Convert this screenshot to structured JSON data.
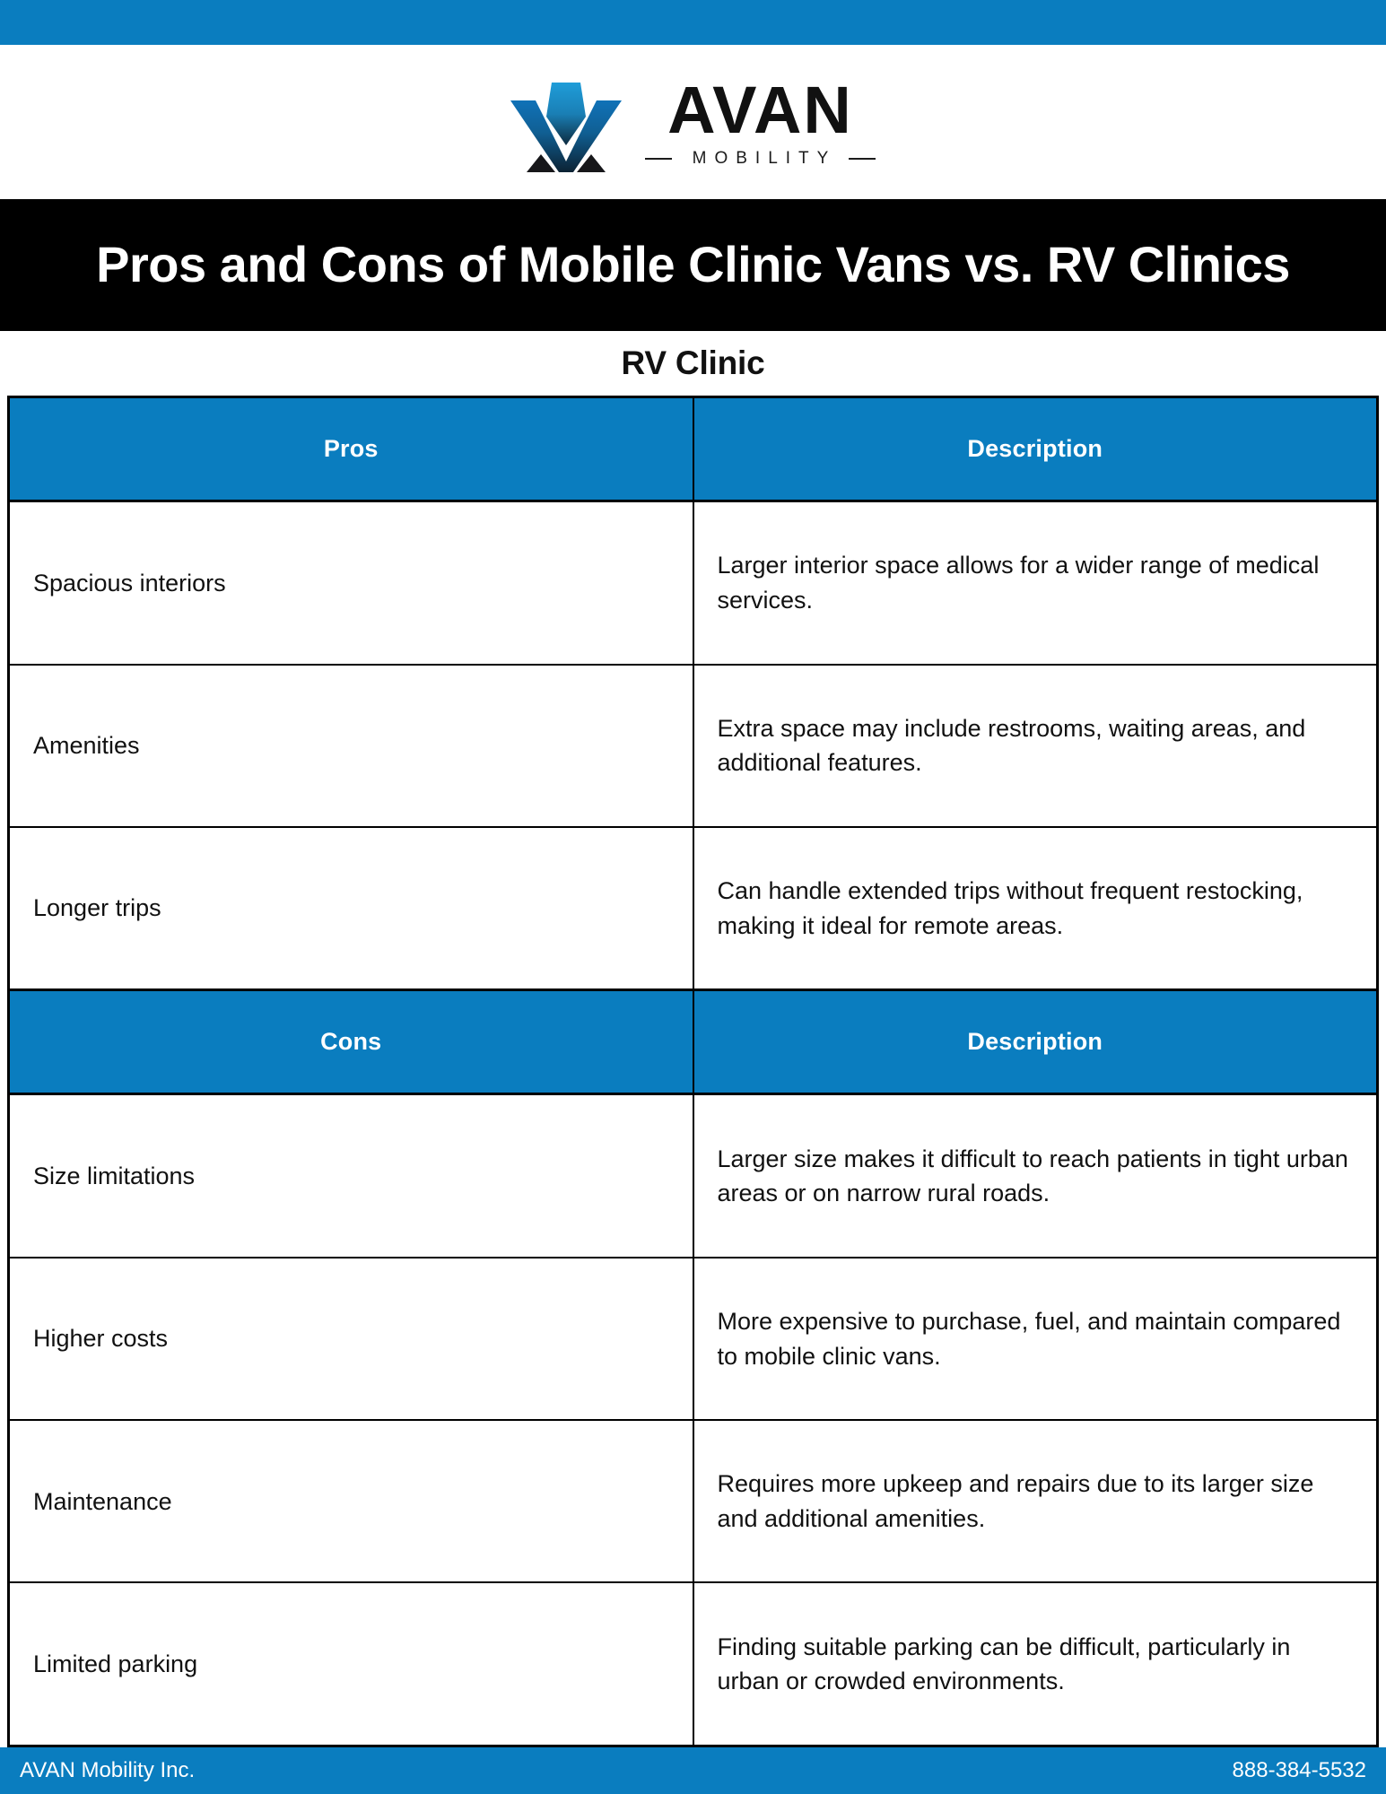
{
  "brand": {
    "accent_color": "#0a7dbf",
    "banner_color": "#000000",
    "logo_word": "AVAN",
    "logo_subtitle": "MOBILITY",
    "logo_mark_name": "avan-v-chevron-logo"
  },
  "title": "Pros and Cons of Mobile Clinic Vans vs. RV Clinics",
  "section_heading": "RV Clinic",
  "table": {
    "sections": [
      {
        "header": {
          "item": "Pros",
          "description": "Description"
        },
        "rows": [
          {
            "item": "Spacious interiors",
            "description": "Larger interior space allows for a wider range of medical services."
          },
          {
            "item": "Amenities",
            "description": "Extra space may include restrooms, waiting areas, and additional features."
          },
          {
            "item": "Longer trips",
            "description": "Can handle extended trips without frequent restocking, making it ideal for remote areas."
          }
        ]
      },
      {
        "header": {
          "item": "Cons",
          "description": "Description"
        },
        "rows": [
          {
            "item": "Size limitations",
            "description": "Larger size makes it difficult to reach patients in tight urban areas or on narrow rural roads."
          },
          {
            "item": "Higher costs",
            "description": "More expensive to purchase, fuel, and maintain compared to mobile clinic vans."
          },
          {
            "item": "Maintenance",
            "description": "Requires more upkeep and repairs due to its larger size and additional amenities."
          },
          {
            "item": "Limited parking",
            "description": "Finding suitable parking can be difficult, particularly in urban or crowded environments."
          }
        ]
      }
    ]
  },
  "footer": {
    "company": "AVAN Mobility Inc.",
    "phone": "888-384-5532"
  }
}
